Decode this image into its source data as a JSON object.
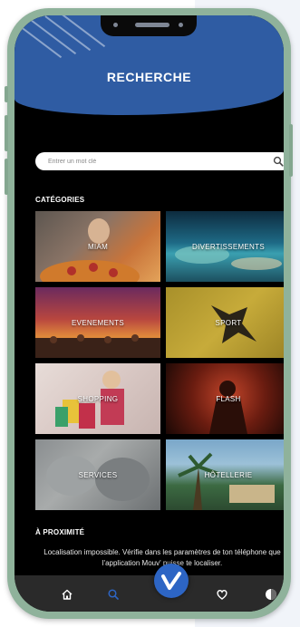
{
  "header": {
    "title": "RECHERCHE"
  },
  "search": {
    "placeholder": "Entrer un mot clé"
  },
  "categories": {
    "label": "CATÉGORIES",
    "items": [
      {
        "label": "MIAM"
      },
      {
        "label": "DIVERTISSEMENTS"
      },
      {
        "label": "EVENEMENTS"
      },
      {
        "label": "SPORT"
      },
      {
        "label": "SHOPPING"
      },
      {
        "label": "FLASH"
      },
      {
        "label": "SERVICES"
      },
      {
        "label": "HÔTELLERIE"
      }
    ]
  },
  "proximity": {
    "label": "À PROXIMITÉ",
    "message": "Localisation impossible. Vérifie  dans les paramètres de ton téléphone que l'application Mouv' puisse te localiser."
  },
  "nav": {
    "items": [
      "home-icon",
      "search-icon",
      "heart-icon",
      "profile-icon"
    ],
    "center": "mouv-logo-icon"
  },
  "colors": {
    "accent": "#2f5ca3",
    "fab": "#2d65c4",
    "screen_bg": "#000000",
    "nav_bg": "#2a2a2a",
    "frame": "#8fb29b"
  }
}
